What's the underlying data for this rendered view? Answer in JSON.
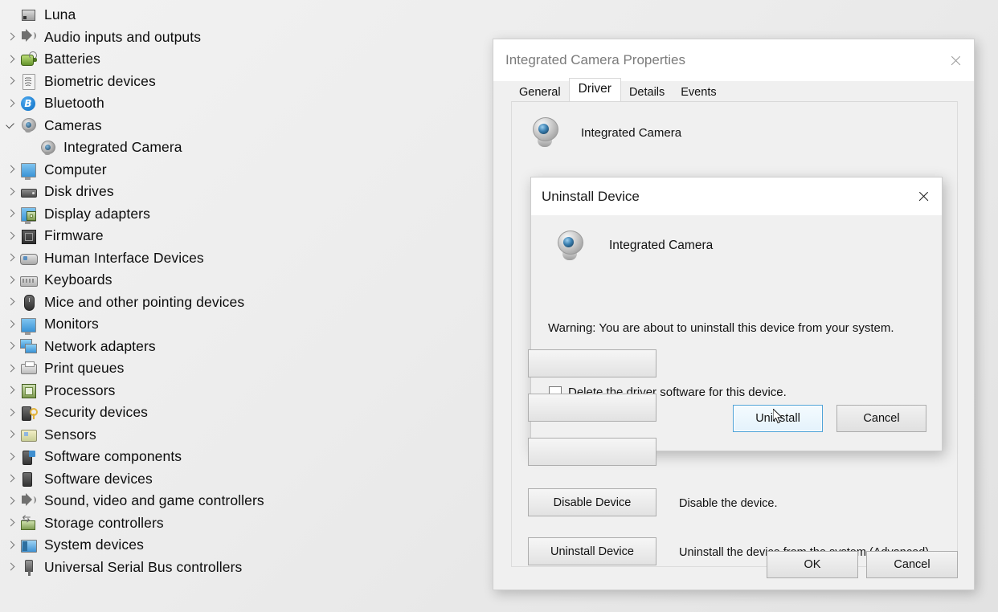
{
  "device_tree": {
    "root": {
      "label": "Luna",
      "icon": "computer-icon",
      "expanded": true
    },
    "items": [
      {
        "label": "Audio inputs and outputs",
        "icon": "speaker-icon",
        "state": "collapsed"
      },
      {
        "label": "Batteries",
        "icon": "battery-icon",
        "state": "collapsed"
      },
      {
        "label": "Biometric devices",
        "icon": "fingerprint-icon",
        "state": "collapsed"
      },
      {
        "label": "Bluetooth",
        "icon": "bluetooth-icon",
        "state": "collapsed"
      },
      {
        "label": "Cameras",
        "icon": "camera-icon",
        "state": "expanded"
      },
      {
        "label": "Integrated Camera",
        "icon": "camera-icon",
        "state": "child"
      },
      {
        "label": "Computer",
        "icon": "monitor-icon",
        "state": "collapsed"
      },
      {
        "label": "Disk drives",
        "icon": "disk-icon",
        "state": "collapsed"
      },
      {
        "label": "Display adapters",
        "icon": "display-adapter-icon",
        "state": "collapsed"
      },
      {
        "label": "Firmware",
        "icon": "firmware-chip-icon",
        "state": "collapsed"
      },
      {
        "label": "Human Interface Devices",
        "icon": "hid-icon",
        "state": "collapsed"
      },
      {
        "label": "Keyboards",
        "icon": "keyboard-icon",
        "state": "collapsed"
      },
      {
        "label": "Mice and other pointing devices",
        "icon": "mouse-icon",
        "state": "collapsed"
      },
      {
        "label": "Monitors",
        "icon": "monitor-icon",
        "state": "collapsed"
      },
      {
        "label": "Network adapters",
        "icon": "network-adapter-icon",
        "state": "collapsed"
      },
      {
        "label": "Print queues",
        "icon": "printer-icon",
        "state": "collapsed"
      },
      {
        "label": "Processors",
        "icon": "processor-chip-icon",
        "state": "collapsed"
      },
      {
        "label": "Security devices",
        "icon": "security-lock-icon",
        "state": "collapsed"
      },
      {
        "label": "Sensors",
        "icon": "sensor-icon",
        "state": "collapsed"
      },
      {
        "label": "Software components",
        "icon": "software-component-icon",
        "state": "collapsed"
      },
      {
        "label": "Software devices",
        "icon": "software-device-icon",
        "state": "collapsed"
      },
      {
        "label": "Sound, video and game controllers",
        "icon": "speaker-icon",
        "state": "collapsed"
      },
      {
        "label": "Storage controllers",
        "icon": "storage-controller-icon",
        "state": "collapsed"
      },
      {
        "label": "System devices",
        "icon": "system-device-icon",
        "state": "collapsed"
      },
      {
        "label": "Universal Serial Bus controllers",
        "icon": "usb-icon",
        "state": "collapsed"
      }
    ]
  },
  "properties_window": {
    "title": "Integrated Camera Properties",
    "close_icon": "close-icon",
    "tabs": [
      {
        "label": "General",
        "active": false
      },
      {
        "label": "Driver",
        "active": true
      },
      {
        "label": "Details",
        "active": false
      },
      {
        "label": "Events",
        "active": false
      }
    ],
    "device_name": "Integrated Camera",
    "device_icon": "camera-icon",
    "driver_actions": [
      {
        "button": "Disable Device",
        "description": "Disable the device."
      },
      {
        "button": "Uninstall Device",
        "description": "Uninstall the device from the system (Advanced)."
      }
    ],
    "footer": {
      "ok_label": "OK",
      "cancel_label": "Cancel"
    }
  },
  "uninstall_modal": {
    "title": "Uninstall Device",
    "close_icon": "close-icon",
    "device_name": "Integrated Camera",
    "device_icon": "camera-icon",
    "warning": "Warning: You are about to uninstall this device from your system.",
    "checkbox": {
      "label": "Delete the driver software for this device.",
      "checked": false
    },
    "buttons": {
      "uninstall_label": "Uninstall",
      "cancel_label": "Cancel",
      "focused": "Uninstall"
    }
  },
  "colors": {
    "window_bg": "#f0f0f0",
    "titlebar_bg": "#ffffff",
    "focus_border": "#4fa3d8",
    "text": "#111111",
    "muted_title": "#7b7b7b"
  }
}
